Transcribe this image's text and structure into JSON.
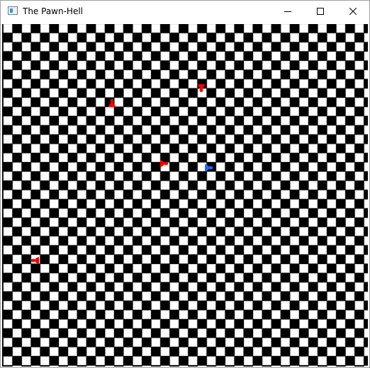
{
  "window": {
    "title": "The Pawn-Hell",
    "icon": "app-window-icon",
    "controls": [
      "minimize-icon",
      "maximize-icon",
      "close-icon"
    ]
  },
  "game": {
    "board": {
      "pattern": "checkerboard",
      "light_color": "#ffffff",
      "dark_color": "#000000",
      "grid_line_color": "#b0b0b0"
    },
    "pieces": [
      {
        "id": "red-pawn-1",
        "color": "#ff0000",
        "team": "red",
        "facing": "down"
      },
      {
        "id": "red-pawn-2",
        "color": "#ff0000",
        "team": "red",
        "facing": "up"
      },
      {
        "id": "red-pawn-3",
        "color": "#ff0000",
        "team": "red",
        "facing": "right"
      },
      {
        "id": "blue-pawn-player",
        "color": "#1a6cff",
        "team": "blue",
        "facing": "right"
      },
      {
        "id": "red-pawn-4",
        "color": "#ff0000",
        "team": "red",
        "facing": "left"
      }
    ]
  }
}
